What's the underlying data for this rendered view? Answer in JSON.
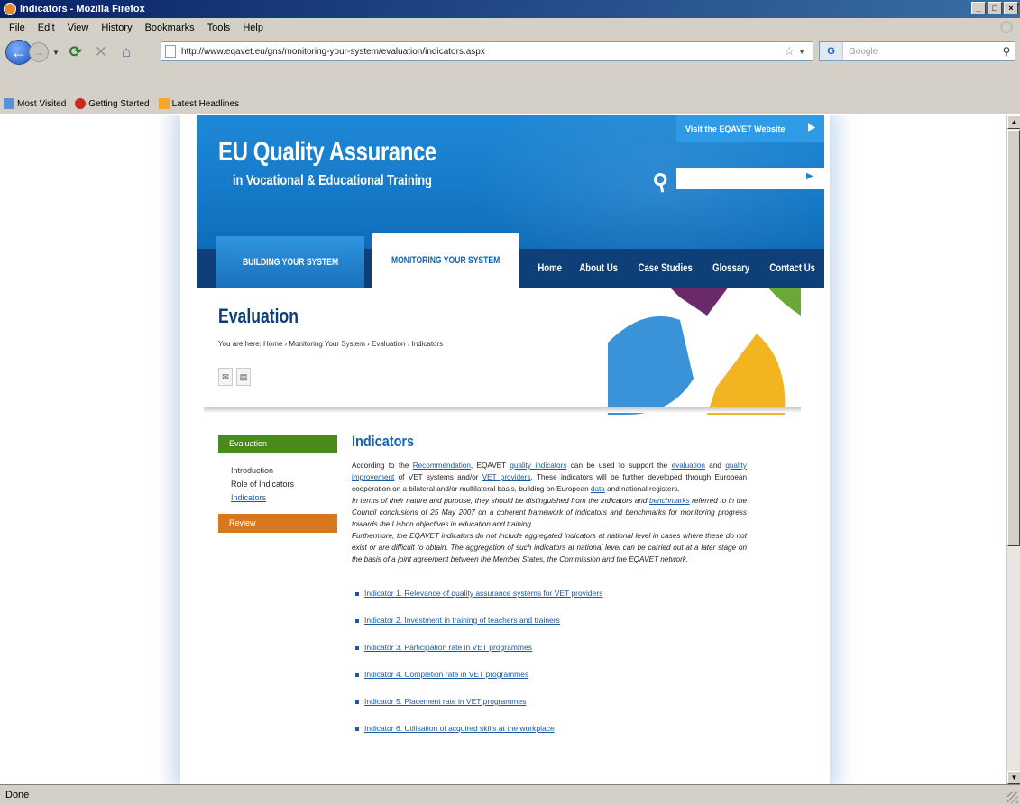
{
  "window": {
    "title": "Indicators - Mozilla Firefox",
    "buttons": [
      "_",
      "□",
      "×"
    ]
  },
  "menu": [
    "File",
    "Edit",
    "View",
    "History",
    "Bookmarks",
    "Tools",
    "Help"
  ],
  "nav": {
    "url": "http://www.eqavet.eu/gns/monitoring-your-system/evaluation/indicators.aspx",
    "search_placeholder": "Google",
    "icons": [
      "back-icon",
      "forward-icon",
      "reload-icon",
      "stop-icon",
      "home-icon",
      "star-icon",
      "search-icon"
    ]
  },
  "bookmarks": [
    "Most Visited",
    "Getting Started",
    "Latest Headlines"
  ],
  "status": "Done",
  "site": {
    "title": "EU Quality Assurance",
    "subtitle": "in Vocational & Educational Training",
    "eqavet_link": "Visit the EQAVET Website",
    "tabs": [
      "Building Your System",
      "Monitoring Your System"
    ],
    "links": [
      "Home",
      "About Us",
      "Case Studies",
      "Glossary",
      "Contact Us"
    ],
    "page_title": "Evaluation",
    "breadcrumb": "You are here: Home › Monitoring Your System › Evaluation › Indicators",
    "sidebar": {
      "section": "Evaluation",
      "items": [
        "Introduction",
        "Role of Indicators",
        "Indicators"
      ],
      "next": "Review"
    },
    "heading": "Indicators",
    "p1": {
      "t1": "According to the ",
      "l1": "Recommendation",
      "t2": ", EQAVET ",
      "l2": "quality indicators",
      "t3": " can be used to support the ",
      "l3": "evaluation",
      "t4": " and ",
      "l4": "quality improvement",
      "t5": " of VET systems and/or ",
      "l5": "VET providers",
      "t6": ". These indicators will be further developed through European cooperation on a bilateral and/or multilateral basis, building on European ",
      "l6": "data",
      "t7": " and national registers."
    },
    "p2": {
      "t1": "In terms of their nature and purpose, they should be distinguished from the indicators and ",
      "l1": "benchmarks",
      "t2": " referred to in the Council conclusions of 25 May 2007 on a coherent framework of indicators and benchmarks for monitoring progress towards the Lisbon objectives in education and training."
    },
    "p3": "Furthermore, the EQAVET indicators do not include aggregated indicators at national level in cases where these do not exist or are difficult to obtain. The aggregation of such indicators at national level can be carried out at a later stage on the basis of a joint agreement between the Member States, the Commission and the EQAVET network.",
    "indicators": [
      "Indicator 1. Relevance of quality assurance systems for VET providers",
      "Indicator 2. Investment in training of teachers and trainers",
      "Indicator 3. Participation rate in VET programmes",
      "Indicator 4. Completion rate in VET programmes",
      "Indicator 5. Placement rate in VET programmes",
      "Indicator 6. Utilisation of acquired skills at the workplace"
    ]
  }
}
